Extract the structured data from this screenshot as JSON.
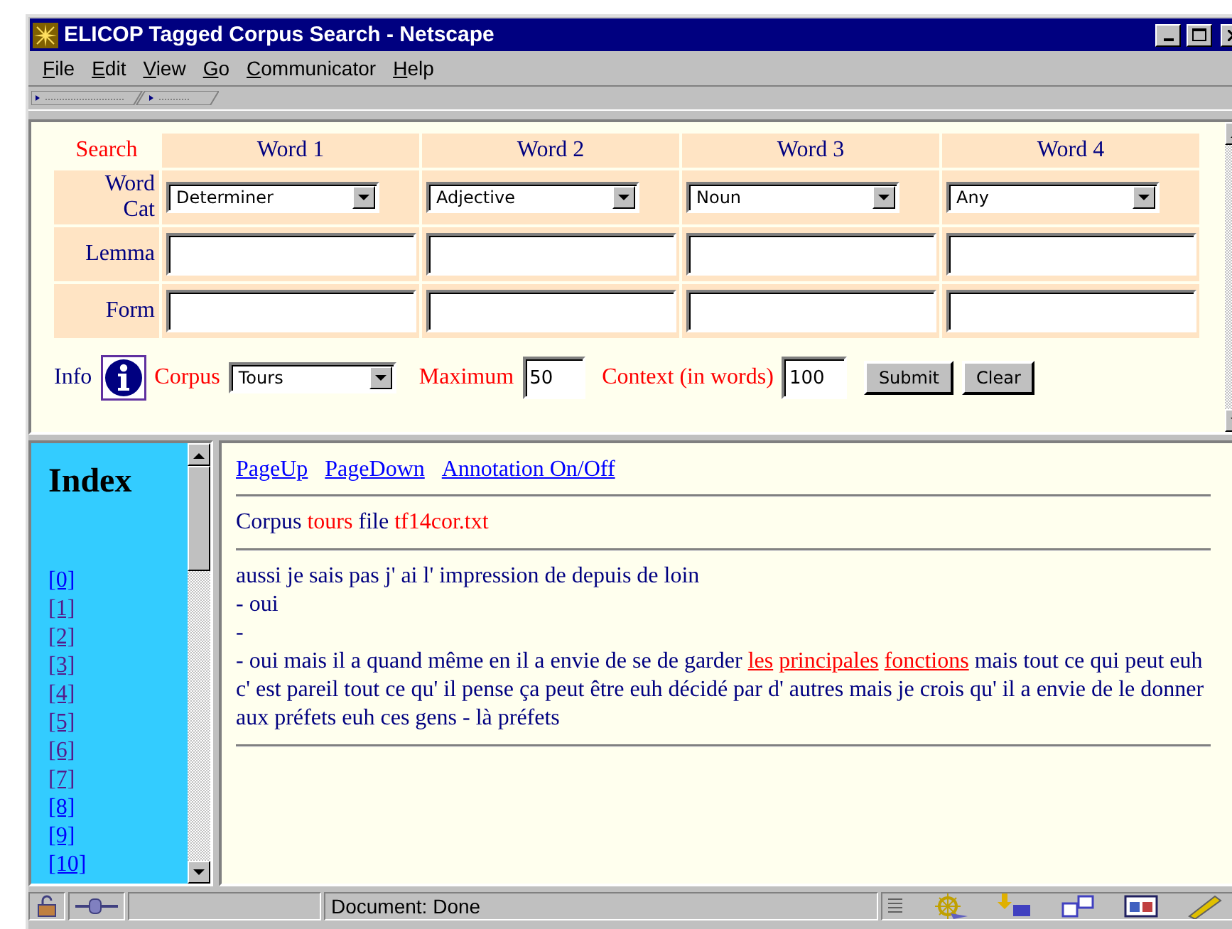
{
  "window": {
    "title": "ELICOP Tagged Corpus Search - Netscape"
  },
  "menu": [
    "File",
    "Edit",
    "View",
    "Go",
    "Communicator",
    "Help"
  ],
  "search_form": {
    "corner": "Search",
    "columns": [
      "Word 1",
      "Word 2",
      "Word 3",
      "Word 4"
    ],
    "category_label": "Word Cat",
    "categories": [
      "Determiner",
      "Adjective",
      "Noun",
      "Any"
    ],
    "rows": [
      {
        "label": "Lemma"
      },
      {
        "label": "Form"
      }
    ],
    "info_label": "Info",
    "corpus_label": "Corpus",
    "corpus": "Tours",
    "maximum_label": "Maximum",
    "maximum": "50",
    "context_label": "Context (in words)",
    "context": "100",
    "buttons": [
      "Submit",
      "Clear"
    ]
  },
  "index": {
    "title": "Index",
    "items": [
      {
        "label": "[0]",
        "visited": false
      },
      {
        "label": "[1]",
        "visited": true
      },
      {
        "label": "[2]",
        "visited": true
      },
      {
        "label": "[3]",
        "visited": true
      },
      {
        "label": "[4]",
        "visited": true
      },
      {
        "label": "[5]",
        "visited": true
      },
      {
        "label": "[6]",
        "visited": true
      },
      {
        "label": "[7]",
        "visited": true
      },
      {
        "label": "[8]",
        "visited": false
      },
      {
        "label": "[9]",
        "visited": false
      },
      {
        "label": "[10]",
        "visited": false
      }
    ]
  },
  "content": {
    "links": [
      "PageUp",
      "PageDown",
      "Annotation On/Off"
    ],
    "source": [
      {
        "text": "Corpus ",
        "kind": "plain"
      },
      {
        "text": "tours",
        "kind": "value"
      },
      {
        "text": " file ",
        "kind": "plain"
      },
      {
        "text": "tf14cor.txt",
        "kind": "value"
      }
    ],
    "lines": [
      [
        {
          "text": "aussi je sais pas j' ai l' impression de depuis de loin",
          "kind": "plain"
        }
      ],
      [
        {
          "text": "- oui",
          "kind": "plain"
        }
      ],
      [
        {
          "text": "-",
          "kind": "plain"
        }
      ],
      [
        {
          "text": "- oui mais il a quand même en il a envie de se de garder ",
          "kind": "plain"
        },
        {
          "text": "les",
          "kind": "link",
          "space_after": true
        },
        {
          "text": "principales",
          "kind": "link",
          "space_after": true
        },
        {
          "text": "fonctions",
          "kind": "link"
        },
        {
          "text": " mais tout ce qui peut euh c' est pareil tout ce qu' il pense ça peut être euh décidé par d' autres mais je crois qu' il a envie de le donner aux préfets euh ces gens - là préfets",
          "kind": "plain"
        }
      ]
    ]
  },
  "status_bar": {
    "text": "Document: Done"
  }
}
